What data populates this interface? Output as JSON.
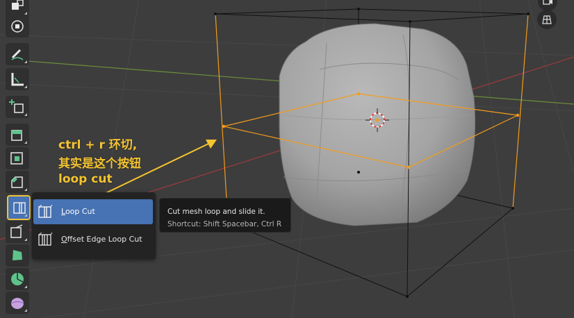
{
  "colors": {
    "viewport_bg": "#3d3d3d",
    "grid_line": "#474747",
    "x_axis": "#9b3b3b",
    "y_axis": "#6a8a3a",
    "selection": "#f39c1d",
    "accent": "#4772b3",
    "annotation": "#f4c430",
    "active_tool_outline": "#f0c23a"
  },
  "toolbar": {
    "tools": [
      {
        "name": "transform-tool",
        "icon": "transform-icon"
      },
      {
        "name": "move-tool",
        "icon": "move-icon"
      },
      {
        "name": "annotate-tool",
        "icon": "pencil-icon"
      },
      {
        "name": "measure-tool",
        "icon": "ruler-icon"
      },
      {
        "name": "add-cube-tool",
        "icon": "add-cube-icon"
      },
      {
        "name": "extrude-region-tool",
        "icon": "extrude-icon"
      },
      {
        "name": "inset-faces-tool",
        "icon": "inset-icon"
      },
      {
        "name": "bevel-tool",
        "icon": "bevel-icon"
      },
      {
        "name": "loop-cut-tool",
        "icon": "loop-cut-icon",
        "active": true
      },
      {
        "name": "knife-tool",
        "icon": "knife-icon"
      },
      {
        "name": "poly-build-tool",
        "icon": "poly-build-icon"
      },
      {
        "name": "spin-tool",
        "icon": "spin-icon"
      },
      {
        "name": "smooth-tool",
        "icon": "smooth-icon"
      }
    ]
  },
  "flyout": {
    "items": [
      {
        "label_prefix": "",
        "label_underline": "L",
        "label_rest": "oop Cut",
        "icon": "loop-cut-icon",
        "selected": true
      },
      {
        "label_prefix": "",
        "label_underline": "O",
        "label_rest": "ffset Edge Loop Cut",
        "icon": "offset-edge-loop-icon",
        "selected": false
      }
    ]
  },
  "tooltip": {
    "description": "Cut mesh loop and slide it.",
    "shortcut": "Shortcut: Shift Spacebar, Ctrl R"
  },
  "annotation": {
    "line1": "ctrl + r 环切,",
    "line2": "其实是这个按钮",
    "line3": "loop cut"
  },
  "gizmos": [
    {
      "name": "camera-view-gizmo",
      "icon": "camera-icon"
    },
    {
      "name": "ortho-toggle-gizmo",
      "icon": "grid-icon"
    }
  ]
}
